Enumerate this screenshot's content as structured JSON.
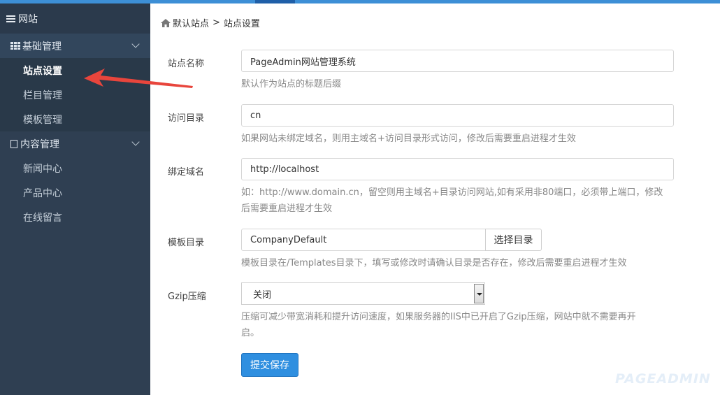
{
  "sidebar": {
    "title": "网站",
    "groups": [
      {
        "label": "基础管理",
        "items": [
          "站点设置",
          "栏目管理",
          "模板管理"
        ]
      },
      {
        "label": "内容管理",
        "items": [
          "新闻中心",
          "产品中心",
          "在线留言"
        ]
      }
    ]
  },
  "breadcrumb": {
    "root": "默认站点",
    "sep": ">",
    "current": "站点设置"
  },
  "form": {
    "site_name": {
      "label": "站点名称",
      "value": "PageAdmin网站管理系统",
      "hint": "默认作为站点的标题后缀"
    },
    "access_dir": {
      "label": "访问目录",
      "value": "cn",
      "hint": "如果网站未绑定域名，则用主域名+访问目录形式访问，修改后需要重启进程才生效"
    },
    "bind_domain": {
      "label": "绑定域名",
      "value": "http://localhost",
      "hint_line1": "如：http://www.domain.cn，留空则用主域名+目录访问网站,如有采用非80端口，必须带上端口，修改",
      "hint_line2": "后需要重启进程才生效"
    },
    "template_dir": {
      "label": "模板目录",
      "value": "CompanyDefault",
      "button": "选择目录",
      "hint": "模板目录在/Templates目录下，填写或修改时请确认目录是否存在，修改后需要重启进程才生效"
    },
    "gzip": {
      "label": "Gzip压缩",
      "selected": "关闭",
      "hint_line1": "压缩可减少带宽消耗和提升访问速度，如果服务器的IIS中已开启了Gzip压缩，网站中就不需要再开",
      "hint_line2": "启。"
    },
    "submit_label": "提交保存"
  },
  "watermark": "PAGEADMIN",
  "colors": {
    "sidebar_bg": "#2f3f52",
    "accent": "#2f8fe0",
    "arrow": "#e8453c"
  }
}
